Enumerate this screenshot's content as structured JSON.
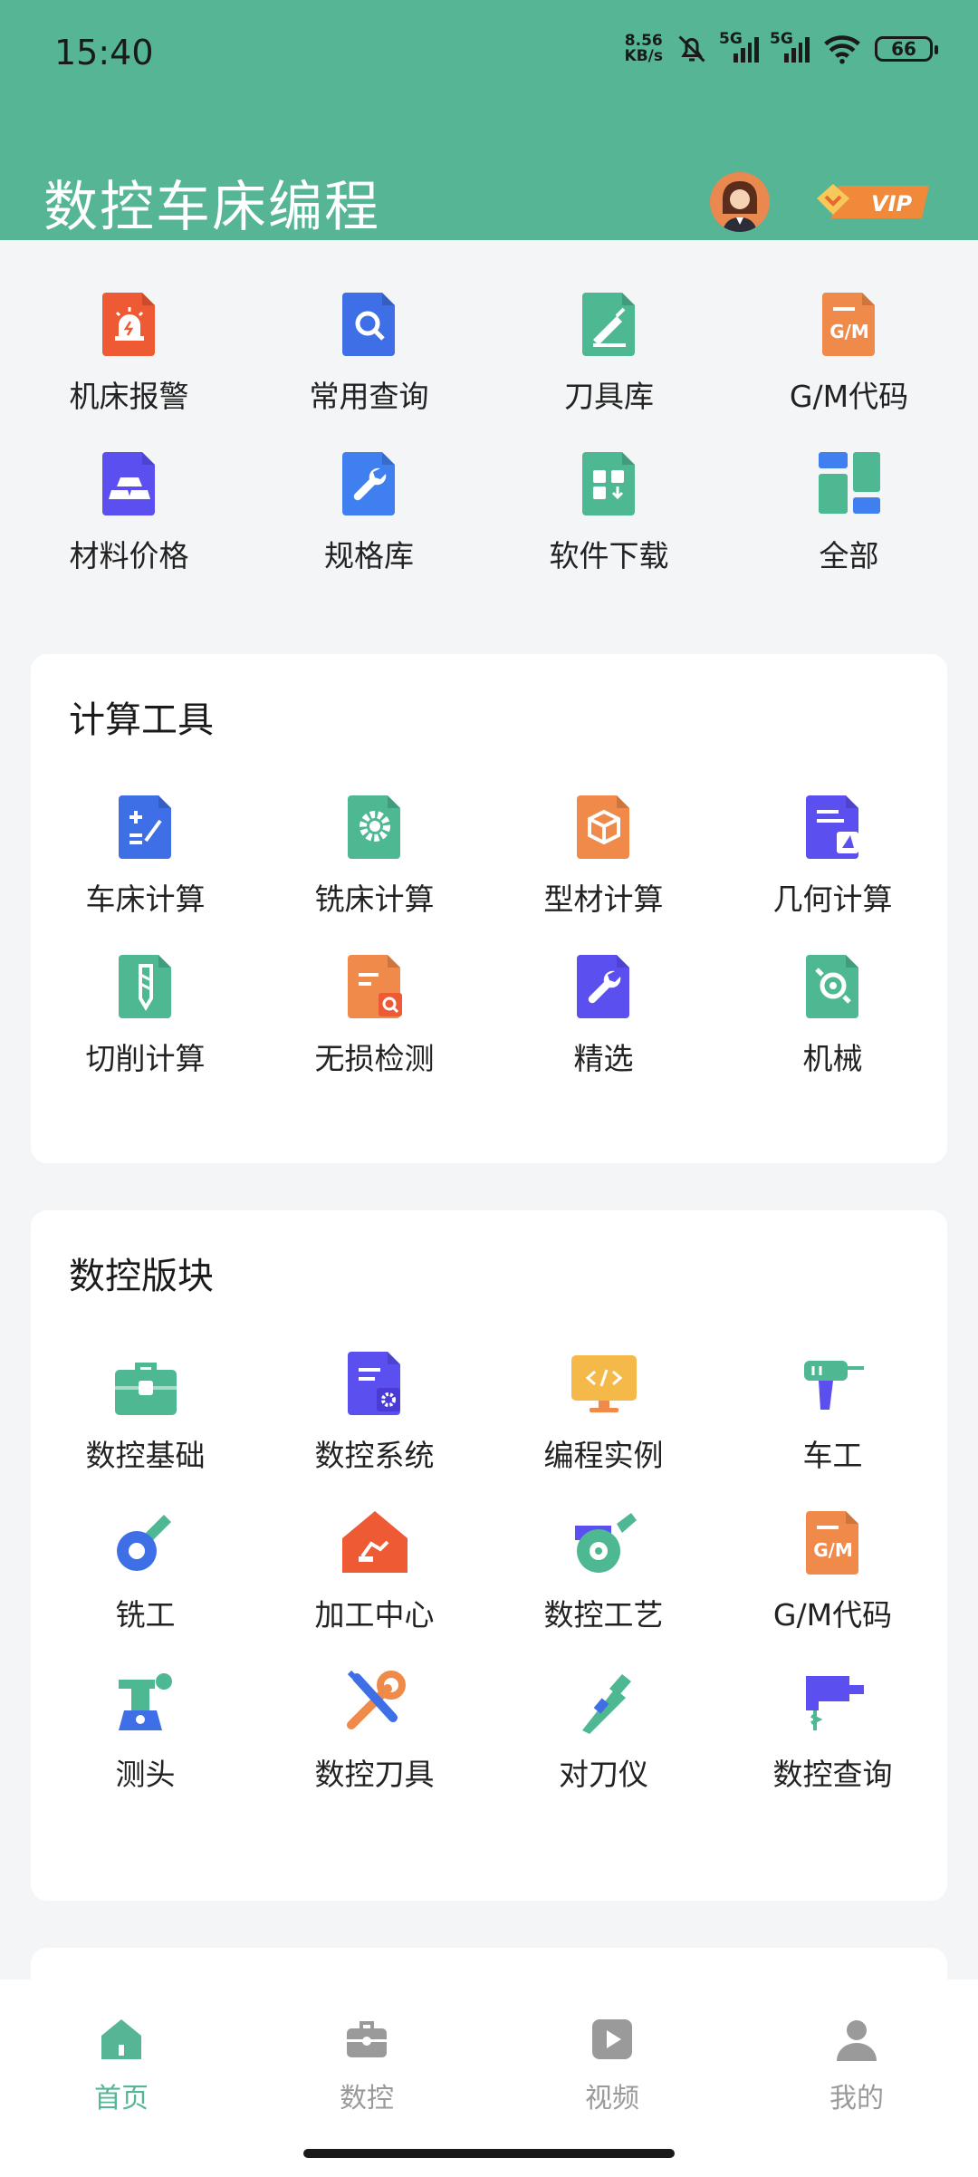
{
  "status": {
    "time": "15:40",
    "speed_value": "8.56",
    "speed_unit": "KB/s",
    "net1": "5G",
    "net2": "5G",
    "battery": "66"
  },
  "header": {
    "title": "数控车床编程"
  },
  "quick": {
    "items": [
      {
        "label": "机床报警",
        "icon": "alarm-icon",
        "color": "#ee5a34"
      },
      {
        "label": "常用查询",
        "icon": "search-doc-icon",
        "color": "#3f6fe6"
      },
      {
        "label": "刀具库",
        "icon": "knife-icon",
        "color": "#4db891"
      },
      {
        "label": "G/M代码",
        "icon": "gm-code-icon",
        "color": "#f08a4b"
      },
      {
        "label": "材料价格",
        "icon": "gold-bars-icon",
        "color": "#5b4ff0"
      },
      {
        "label": "规格库",
        "icon": "wrench-icon",
        "color": "#3f7ff0"
      },
      {
        "label": "软件下载",
        "icon": "download-icon",
        "color": "#4db891"
      },
      {
        "label": "全部",
        "icon": "all-grid-icon",
        "color": "#3f7ff0"
      }
    ]
  },
  "calc": {
    "title": "计算工具",
    "items": [
      {
        "label": "车床计算",
        "icon": "calculator-icon",
        "color": "#3f6fe6"
      },
      {
        "label": "铣床计算",
        "icon": "gear-icon",
        "color": "#4db891"
      },
      {
        "label": "型材计算",
        "icon": "box-icon",
        "color": "#f08a4b"
      },
      {
        "label": "几何计算",
        "icon": "geometry-icon",
        "color": "#5b4ff0"
      },
      {
        "label": "切削计算",
        "icon": "drill-bit-icon",
        "color": "#4db891"
      },
      {
        "label": "无损检测",
        "icon": "inspect-icon",
        "color": "#f08a4b"
      },
      {
        "label": "精选",
        "icon": "wrench-icon",
        "color": "#5b4ff0"
      },
      {
        "label": "机械",
        "icon": "mechanical-icon",
        "color": "#4db891"
      }
    ]
  },
  "cnc": {
    "title": "数控版块",
    "items": [
      {
        "label": "数控基础",
        "icon": "toolbox-icon",
        "color": "#4db891"
      },
      {
        "label": "数控系统",
        "icon": "system-doc-icon",
        "color": "#5b4ff0"
      },
      {
        "label": "编程实例",
        "icon": "code-monitor-icon",
        "color": "#f5b94a"
      },
      {
        "label": "车工",
        "icon": "drill-gun-icon",
        "color": "#4db891"
      },
      {
        "label": "铣工",
        "icon": "grinder-icon",
        "color": "#3f6fe6"
      },
      {
        "label": "加工中心",
        "icon": "factory-icon",
        "color": "#ee5a34"
      },
      {
        "label": "数控工艺",
        "icon": "saw-icon",
        "color": "#4db891"
      },
      {
        "label": "G/M代码",
        "icon": "gm-code-icon",
        "color": "#f08a4b"
      },
      {
        "label": "测头",
        "icon": "probe-icon",
        "color": "#4db891"
      },
      {
        "label": "数控刀具",
        "icon": "tools-cross-icon",
        "color": "#f08a4b"
      },
      {
        "label": "对刀仪",
        "icon": "tool-setter-icon",
        "color": "#4db891"
      },
      {
        "label": "数控查询",
        "icon": "jigsaw-icon",
        "color": "#5b4ff0"
      }
    ]
  },
  "tabs": [
    {
      "label": "首页",
      "icon": "home-icon",
      "active": true
    },
    {
      "label": "数控",
      "icon": "toolbox-icon",
      "active": false
    },
    {
      "label": "视频",
      "icon": "video-icon",
      "active": false
    },
    {
      "label": "我的",
      "icon": "user-icon",
      "active": false
    }
  ],
  "colors": {
    "accent": "#55b595",
    "inactive": "#9a9a9a"
  }
}
